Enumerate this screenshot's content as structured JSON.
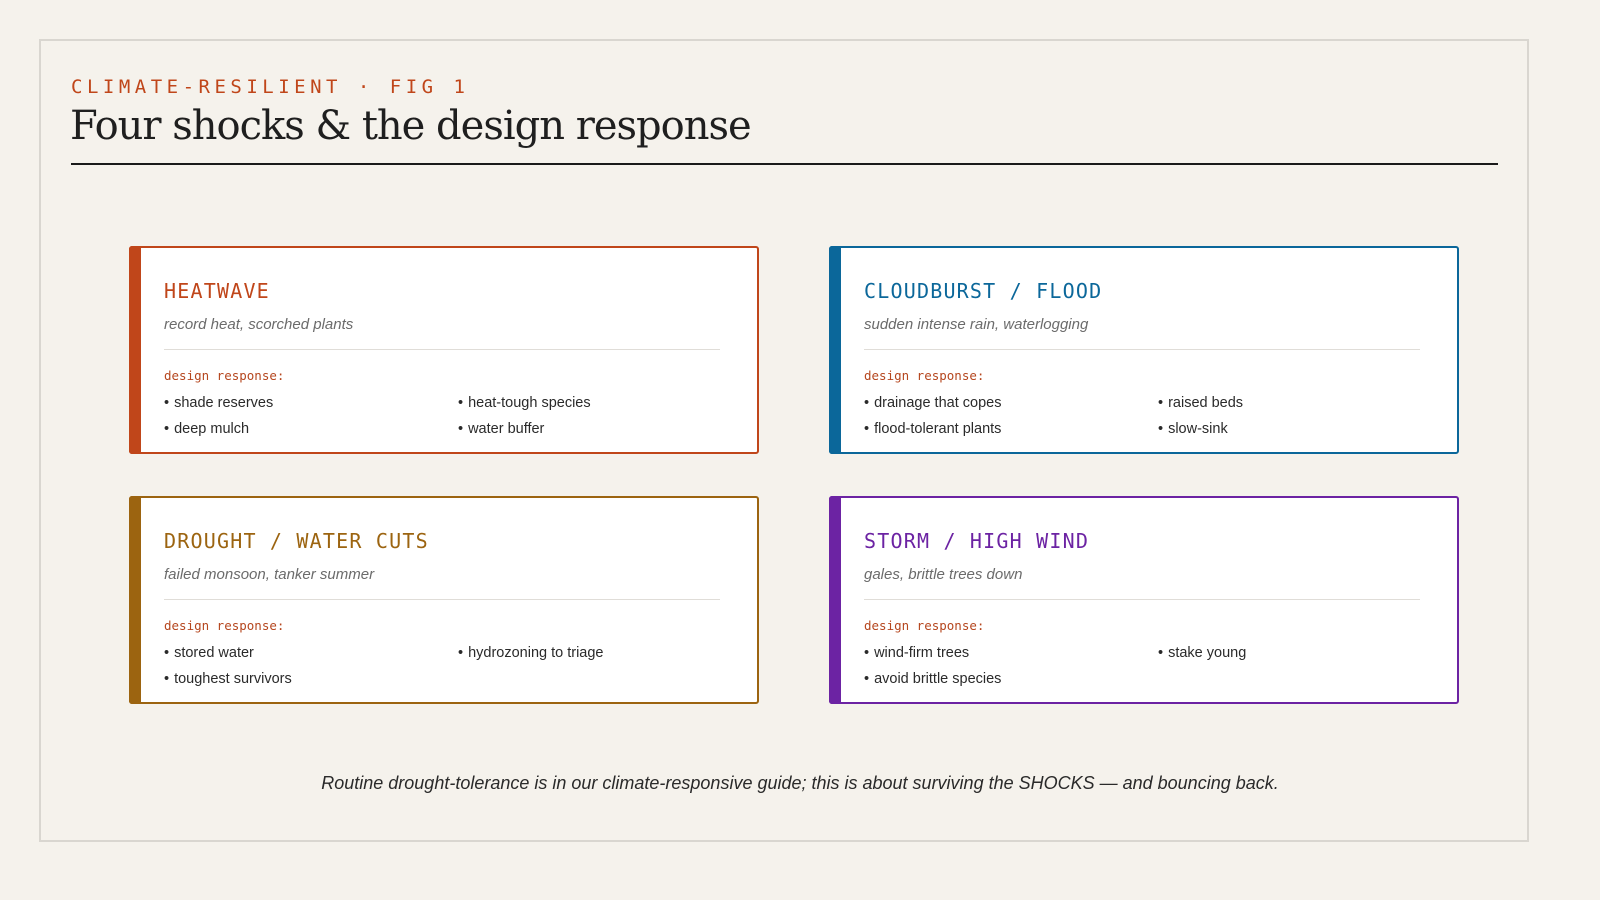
{
  "header": {
    "kicker": "CLIMATE-RESILIENT · FIG 1",
    "title": "Four shocks & the design response"
  },
  "response_label": "design response:",
  "bullet": "•",
  "cards": [
    {
      "title": "HEATWAVE",
      "subtitle": "record heat, scorched plants",
      "accent": "#c0461a",
      "responses": [
        "shade reserves",
        "heat-tough species",
        "deep mulch",
        "water buffer"
      ]
    },
    {
      "title": "CLOUDBURST / FLOOD",
      "subtitle": "sudden intense rain, waterlogging",
      "accent": "#0b679a",
      "responses": [
        "drainage that copes",
        "raised beds",
        "flood-tolerant plants",
        "slow-sink"
      ]
    },
    {
      "title": "DROUGHT / WATER CUTS",
      "subtitle": "failed monsoon, tanker summer",
      "accent": "#9c6410",
      "responses": [
        "stored water",
        "hydrozoning to triage",
        "toughest survivors"
      ]
    },
    {
      "title": "STORM / HIGH WIND",
      "subtitle": "gales, brittle trees down",
      "accent": "#6c23a3",
      "responses": [
        "wind-firm trees",
        "stake young",
        "avoid brittle species"
      ]
    }
  ],
  "footer": "Routine drought-tolerance is in our climate-responsive guide; this is about surviving the SHOCKS — and bouncing back."
}
